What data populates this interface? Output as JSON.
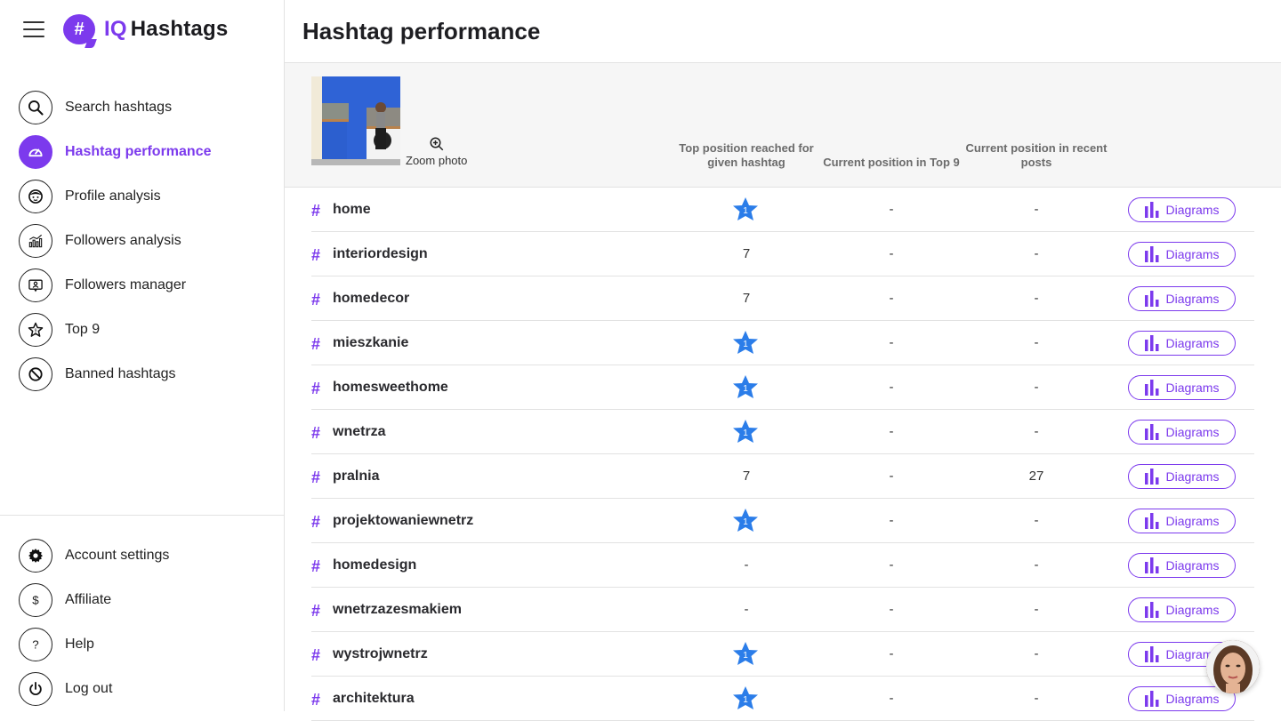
{
  "brand": {
    "prefix": "IQ",
    "name": "Hashtags",
    "logo_glyph": "#"
  },
  "sidebar": {
    "items": [
      {
        "label": "Search hashtags",
        "icon": "search-icon",
        "active": false
      },
      {
        "label": "Hashtag performance",
        "icon": "gauge-icon",
        "active": true
      },
      {
        "label": "Profile analysis",
        "icon": "face-icon",
        "active": false
      },
      {
        "label": "Followers analysis",
        "icon": "chart-icon",
        "active": false
      },
      {
        "label": "Followers manager",
        "icon": "user-card-icon",
        "active": false
      },
      {
        "label": "Top 9",
        "icon": "star-icon",
        "active": false
      },
      {
        "label": "Banned hashtags",
        "icon": "ban-icon",
        "active": false
      }
    ],
    "bottom_items": [
      {
        "label": "Account settings",
        "icon": "gear-icon"
      },
      {
        "label": "Affiliate",
        "icon": "dollar-icon"
      },
      {
        "label": "Help",
        "icon": "question-icon"
      },
      {
        "label": "Log out",
        "icon": "power-icon"
      }
    ]
  },
  "page": {
    "title": "Hashtag performance",
    "zoom_photo_label": "Zoom photo",
    "columns": {
      "top_position": "Top position reached for given hashtag",
      "current_top9": "Current position in Top 9",
      "current_recent": "Current position in recent posts"
    },
    "diagrams_label": "Diagrams",
    "rows": [
      {
        "tag": "home",
        "top": "1",
        "top_star": true,
        "top9": "-",
        "recent": "-"
      },
      {
        "tag": "interiordesign",
        "top": "7",
        "top_star": false,
        "top9": "-",
        "recent": "-"
      },
      {
        "tag": "homedecor",
        "top": "7",
        "top_star": false,
        "top9": "-",
        "recent": "-"
      },
      {
        "tag": "mieszkanie",
        "top": "1",
        "top_star": true,
        "top9": "-",
        "recent": "-"
      },
      {
        "tag": "homesweethome",
        "top": "1",
        "top_star": true,
        "top9": "-",
        "recent": "-"
      },
      {
        "tag": "wnetrza",
        "top": "1",
        "top_star": true,
        "top9": "-",
        "recent": "-"
      },
      {
        "tag": "pralnia",
        "top": "7",
        "top_star": false,
        "top9": "-",
        "recent": "27"
      },
      {
        "tag": "projektowaniewnetrz",
        "top": "1",
        "top_star": true,
        "top9": "-",
        "recent": "-"
      },
      {
        "tag": "homedesign",
        "top": "-",
        "top_star": false,
        "top9": "-",
        "recent": "-"
      },
      {
        "tag": "wnetrzazesmakiem",
        "top": "-",
        "top_star": false,
        "top9": "-",
        "recent": "-"
      },
      {
        "tag": "wystrojwnetrz",
        "top": "1",
        "top_star": true,
        "top9": "-",
        "recent": "-"
      },
      {
        "tag": "architektura",
        "top": "1",
        "top_star": true,
        "top9": "-",
        "recent": "-"
      }
    ]
  },
  "colors": {
    "accent": "#7c3aed",
    "star": "#2b7de9"
  }
}
